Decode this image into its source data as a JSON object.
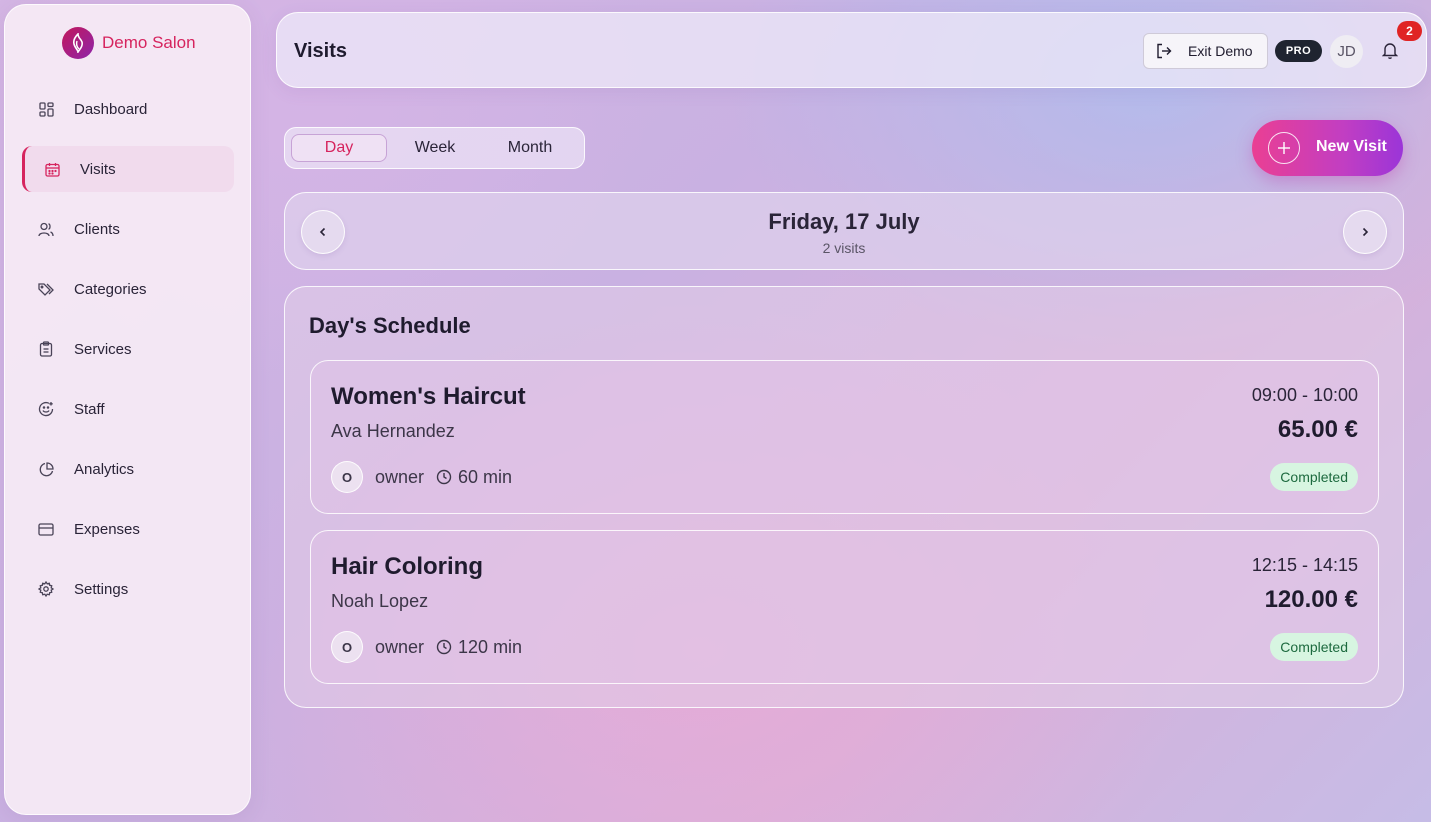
{
  "brand": {
    "name": "Demo Salon",
    "logo_icon": "salon-logo-icon"
  },
  "sidebar": {
    "items": [
      {
        "label": "Dashboard",
        "icon": "dashboard-icon"
      },
      {
        "label": "Visits",
        "icon": "calendar-icon",
        "active": true
      },
      {
        "label": "Clients",
        "icon": "users-icon"
      },
      {
        "label": "Categories",
        "icon": "tags-icon"
      },
      {
        "label": "Services",
        "icon": "clipboard-icon"
      },
      {
        "label": "Staff",
        "icon": "smile-icon"
      },
      {
        "label": "Analytics",
        "icon": "pie-chart-icon"
      },
      {
        "label": "Expenses",
        "icon": "credit-card-icon"
      },
      {
        "label": "Settings",
        "icon": "gear-icon"
      }
    ]
  },
  "header": {
    "title": "Visits",
    "exit_label": "Exit Demo",
    "plan_badge": "PRO",
    "avatar_initials": "JD",
    "notification_count": "2"
  },
  "view_toggle": {
    "options": [
      "Day",
      "Week",
      "Month"
    ],
    "selected": "Day"
  },
  "new_visit_label": "New Visit",
  "date_nav": {
    "date": "Friday, 17 July",
    "subtitle": "2 visits"
  },
  "schedule": {
    "title": "Day's Schedule",
    "visits": [
      {
        "service": "Women's Haircut",
        "client": "Ava Hernandez",
        "staff_initial": "O",
        "staff": "owner",
        "duration": "60 min",
        "time": "09:00 - 10:00",
        "price": "65.00 €",
        "status": "Completed"
      },
      {
        "service": "Hair Coloring",
        "client": "Noah Lopez",
        "staff_initial": "O",
        "staff": "owner",
        "duration": "120 min",
        "time": "12:15 - 14:15",
        "price": "120.00 €",
        "status": "Completed"
      }
    ]
  },
  "colors": {
    "accent": "#d6245e",
    "status_completed_bg": "#d7f5e1",
    "status_completed_text": "#1d6a3f",
    "notification_badge": "#e02424"
  }
}
